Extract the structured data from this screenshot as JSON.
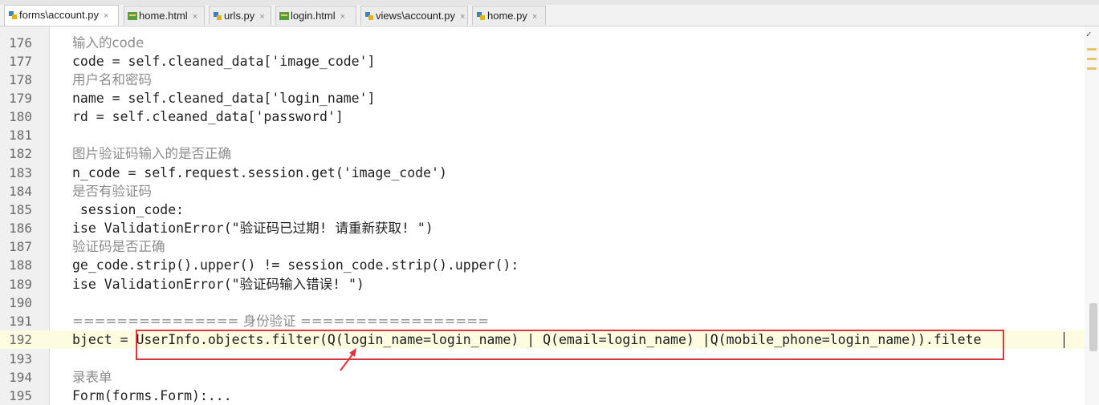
{
  "tabs": [
    {
      "label": "forms\\account.py",
      "icon": "python-file-icon",
      "active": true
    },
    {
      "label": "home.html",
      "icon": "html-file-icon",
      "active": false
    },
    {
      "label": "urls.py",
      "icon": "python-file-icon",
      "active": false
    },
    {
      "label": "login.html",
      "icon": "html-file-icon",
      "active": false
    },
    {
      "label": "views\\account.py",
      "icon": "python-file-icon",
      "active": false
    },
    {
      "label": "home.py",
      "icon": "python-file-icon",
      "active": false
    }
  ],
  "close_glyph": "×",
  "editor": {
    "current_line": "192",
    "lines": [
      {
        "n": "176",
        "t": "输入的code"
      },
      {
        "n": "177",
        "t": "code = self.cleaned_data['image_code']"
      },
      {
        "n": "178",
        "t": "用户名和密码"
      },
      {
        "n": "179",
        "t": "name = self.cleaned_data['login_name']"
      },
      {
        "n": "180",
        "t": "rd = self.cleaned_data['password']"
      },
      {
        "n": "181",
        "t": ""
      },
      {
        "n": "182",
        "t": "图片验证码输入的是否正确"
      },
      {
        "n": "183",
        "t": "n_code = self.request.session.get('image_code')"
      },
      {
        "n": "184",
        "t": "是否有验证码"
      },
      {
        "n": "185",
        "t": " session_code:"
      },
      {
        "n": "186",
        "t": "ise ValidationError(\"验证码已过期! 请重新获取! \")"
      },
      {
        "n": "187",
        "t": "验证码是否正确"
      },
      {
        "n": "188",
        "t": "ge_code.strip().upper() != session_code.strip().upper():"
      },
      {
        "n": "189",
        "t": "ise ValidationError(\"验证码输入错误! \")"
      },
      {
        "n": "190",
        "t": ""
      },
      {
        "n": "191",
        "t": "=============== 身份验证 ================="
      },
      {
        "n": "192",
        "t": "bject = UserInfo.objects.filter(Q(login_name=login_name) | Q(email=login_name) |Q(mobile_phone=login_name)).filete"
      },
      {
        "n": "193",
        "t": ""
      },
      {
        "n": "194",
        "t": "录表单"
      },
      {
        "n": "195",
        "t": "Form(forms.Form):..."
      }
    ]
  },
  "annotation": {
    "box_color": "#d9363e",
    "arrow_color": "#d9363e"
  }
}
